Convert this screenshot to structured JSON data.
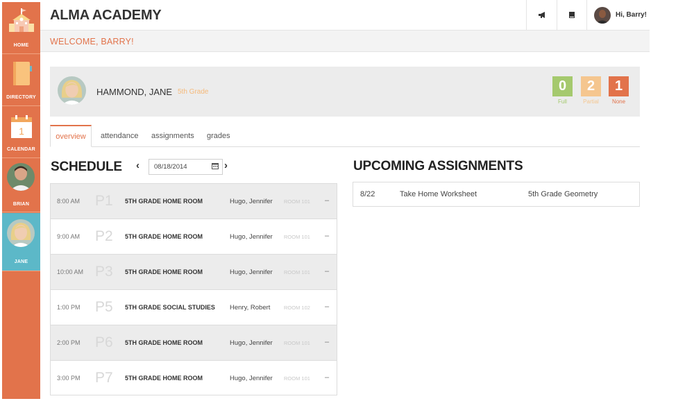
{
  "sidebar": {
    "items": [
      {
        "label": "HOME",
        "icon": "school-icon"
      },
      {
        "label": "DIRECTORY",
        "icon": "book-icon"
      },
      {
        "label": "CALENDAR",
        "icon": "calendar-icon",
        "day": "1"
      },
      {
        "label": "BRIAN",
        "icon": "avatar"
      },
      {
        "label": "JANE",
        "icon": "avatar",
        "active": true
      }
    ]
  },
  "header": {
    "title": "ALMA ACADEMY",
    "icons": [
      "megaphone-icon",
      "book-icon"
    ],
    "user_greeting": "Hi, Barry!"
  },
  "welcome": {
    "text": "WELCOME, BARRY!"
  },
  "student": {
    "name": "HAMMOND, JANE",
    "grade": "5th Grade",
    "scores": [
      {
        "value": "0",
        "label": "Full",
        "color": "#a5c96e"
      },
      {
        "value": "2",
        "label": "Partial",
        "color": "#f5c68f"
      },
      {
        "value": "1",
        "label": "None",
        "color": "#e2734b"
      }
    ]
  },
  "tabs": [
    "overview",
    "attendance",
    "assignments",
    "grades"
  ],
  "schedule": {
    "title": "SCHEDULE",
    "date": "08/18/2014",
    "rows": [
      {
        "time": "8:00 AM",
        "period": "P1",
        "class": "5TH GRADE HOME ROOM",
        "teacher": "Hugo, Jennifer",
        "room": "ROOM 101"
      },
      {
        "time": "9:00 AM",
        "period": "P2",
        "class": "5TH GRADE HOME ROOM",
        "teacher": "Hugo, Jennifer",
        "room": "ROOM 101"
      },
      {
        "time": "10:00 AM",
        "period": "P3",
        "class": "5TH GRADE HOME ROOM",
        "teacher": "Hugo, Jennifer",
        "room": "ROOM 101"
      },
      {
        "time": "1:00 PM",
        "period": "P5",
        "class": "5TH GRADE SOCIAL STUDIES",
        "teacher": "Henry, Robert",
        "room": "ROOM 102"
      },
      {
        "time": "2:00 PM",
        "period": "P6",
        "class": "5TH GRADE HOME ROOM",
        "teacher": "Hugo, Jennifer",
        "room": "ROOM 101"
      },
      {
        "time": "3:00 PM",
        "period": "P7",
        "class": "5TH GRADE HOME ROOM",
        "teacher": "Hugo, Jennifer",
        "room": "ROOM 101"
      }
    ]
  },
  "upcoming": {
    "title": "UPCOMING ASSIGNMENTS",
    "rows": [
      {
        "date": "8/22",
        "name": "Take Home Worksheet",
        "course": "5th Grade Geometry"
      }
    ]
  },
  "colors": {
    "accent": "#e2734b",
    "active_sidebar": "#5cb8c8"
  }
}
